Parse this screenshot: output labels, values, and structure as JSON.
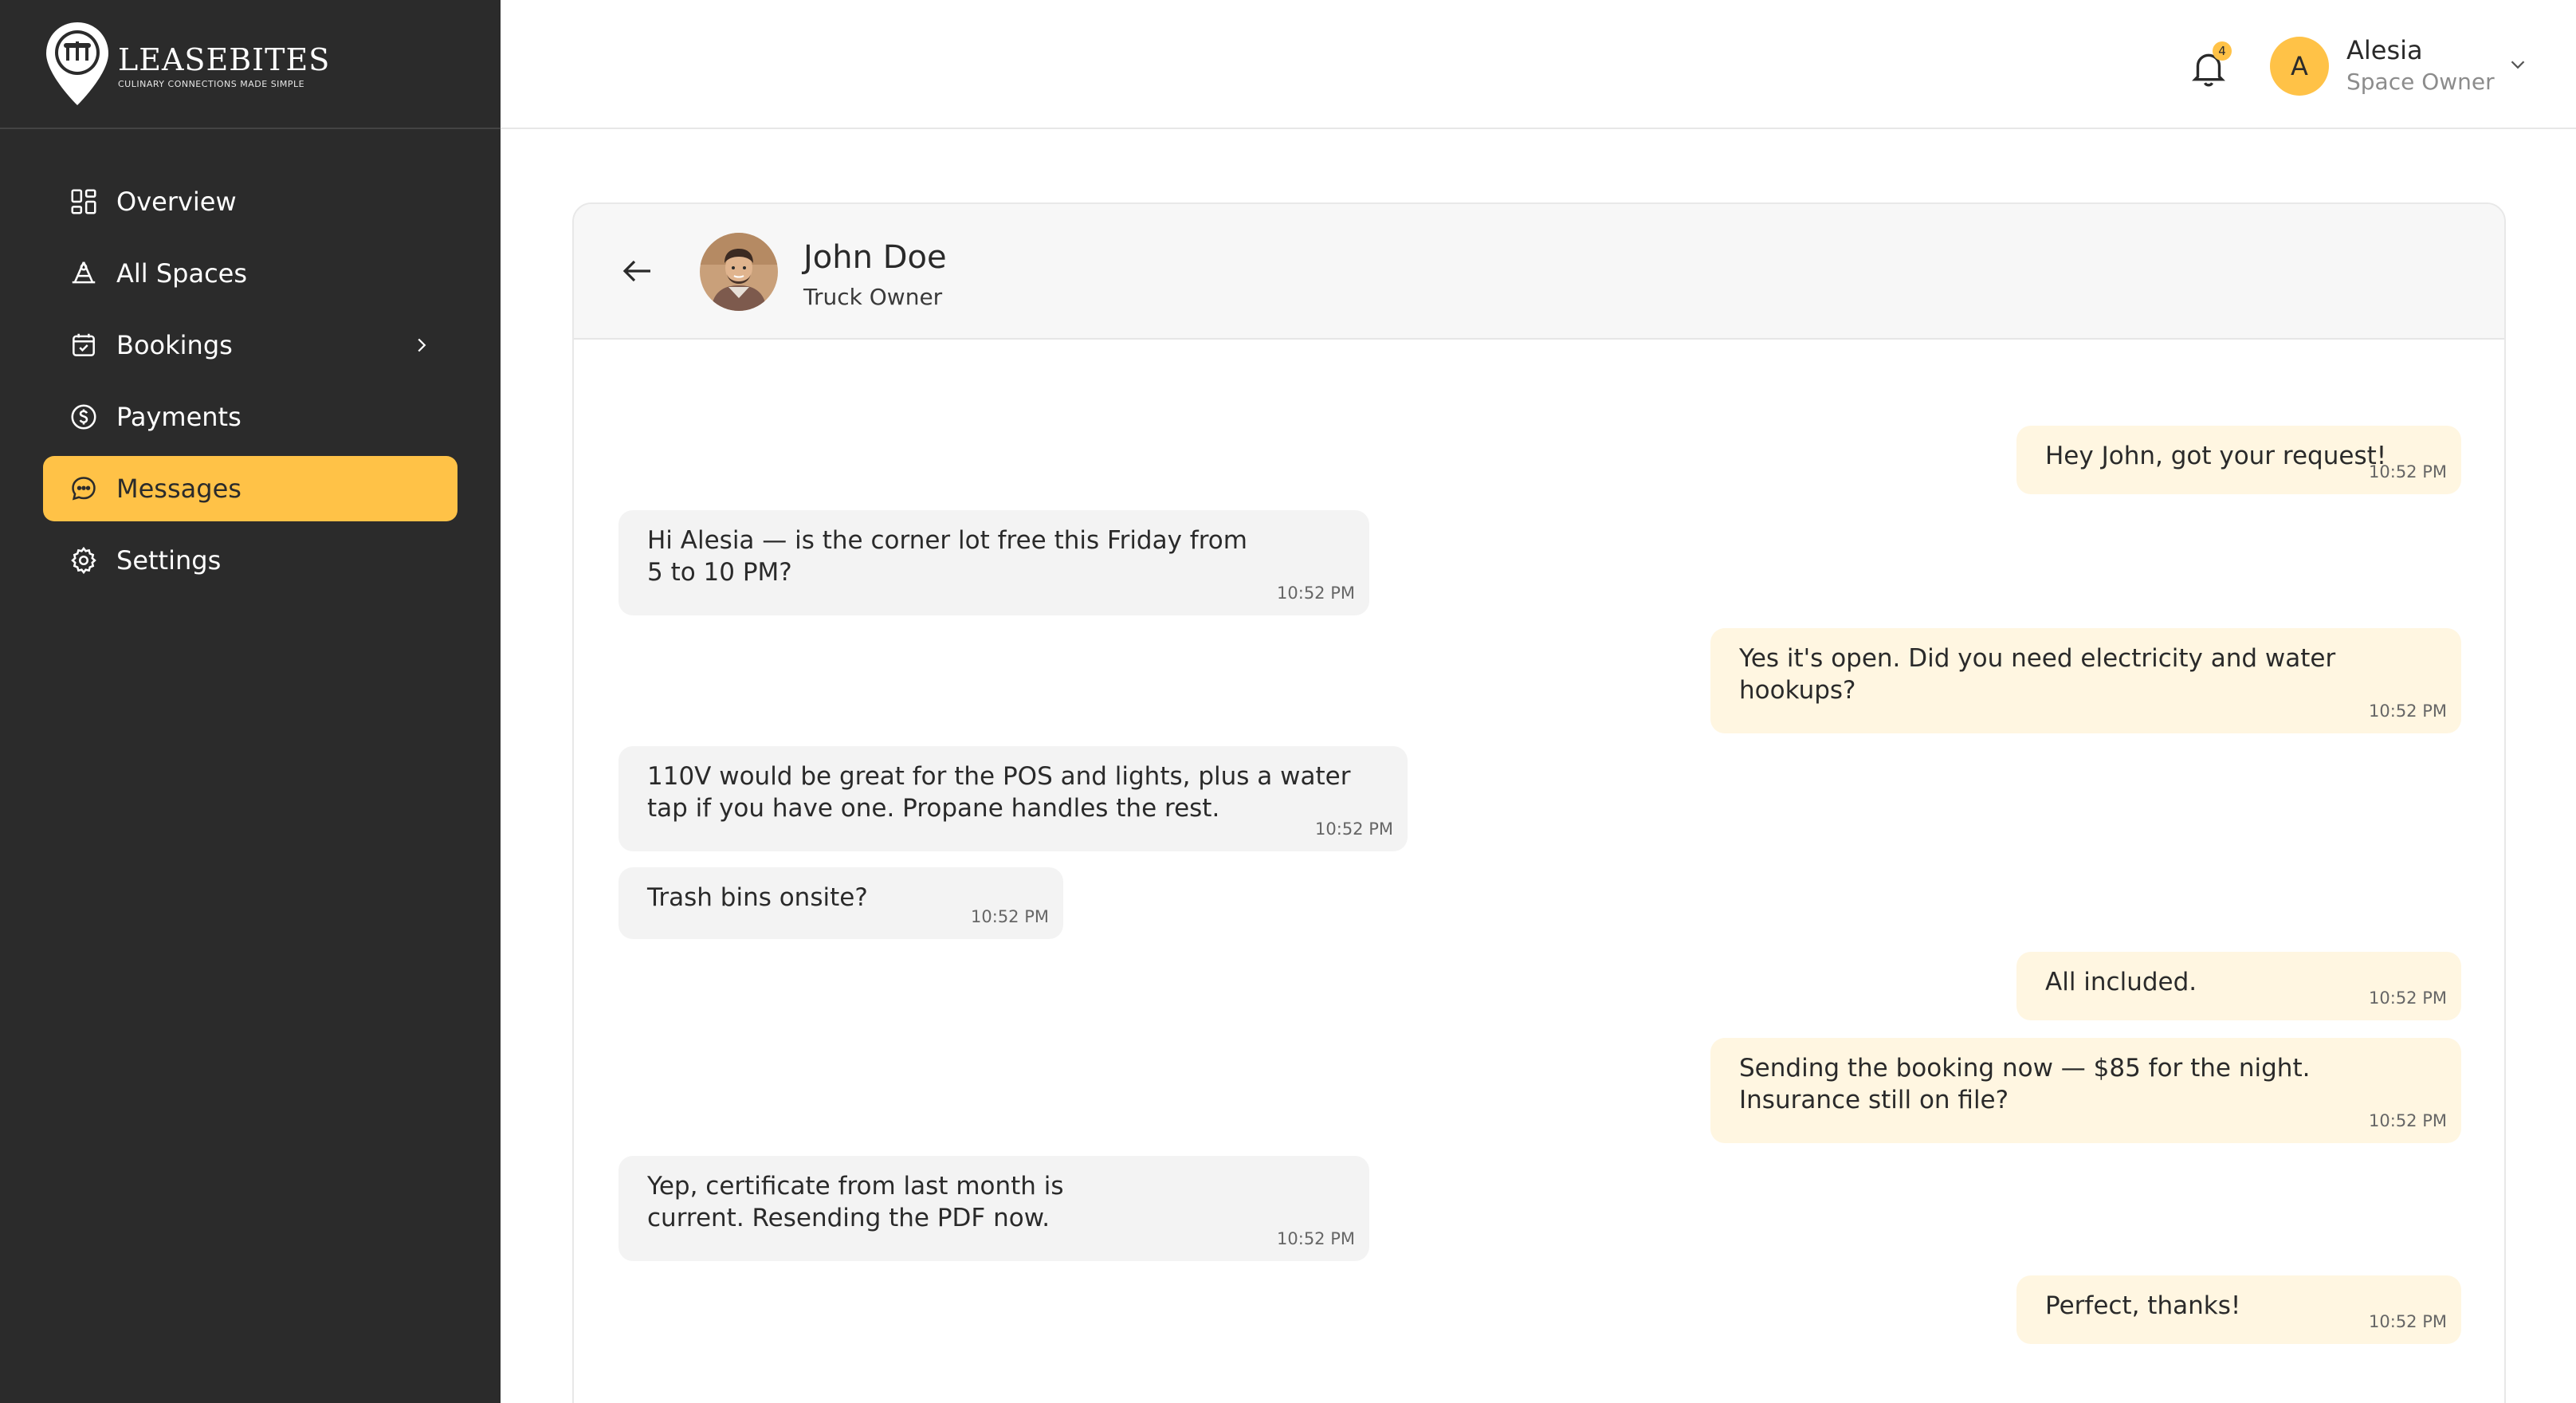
{
  "brand": {
    "name": "LEASEBITES",
    "tagline": "CULINARY CONNECTIONS MADE SIMPLE"
  },
  "sidebar": {
    "items": [
      {
        "label": "Overview",
        "icon": "grid-icon"
      },
      {
        "label": "All Spaces",
        "icon": "spaces-icon"
      },
      {
        "label": "Bookings",
        "icon": "calendar-icon",
        "has_submenu": true
      },
      {
        "label": "Payments",
        "icon": "dollar-circle-icon"
      },
      {
        "label": "Messages",
        "icon": "chat-bubble-icon",
        "active": true
      },
      {
        "label": "Settings",
        "icon": "gear-icon"
      }
    ]
  },
  "header": {
    "notification_count": "4",
    "user": {
      "initial": "A",
      "name": "Alesia",
      "role": "Space Owner"
    }
  },
  "chat": {
    "contact": {
      "name": "John Doe",
      "role": "Truck Owner"
    },
    "messages": [
      {
        "direction": "out",
        "text": "Hey John, got your request!",
        "time": "10:52 PM"
      },
      {
        "direction": "in",
        "text": "Hi Alesia — is the corner lot free this Friday from 5 to 10 PM?",
        "time": "10:52 PM"
      },
      {
        "direction": "out",
        "text": "Yes it's open. Did you need electricity and water hookups?",
        "time": "10:52 PM"
      },
      {
        "direction": "in",
        "text": "110V would be great for the POS and lights, plus a water tap if you have one. Propane handles the rest.",
        "time": "10:52 PM"
      },
      {
        "direction": "in",
        "text": "Trash bins onsite?",
        "time": "10:52 PM"
      },
      {
        "direction": "out",
        "text": "All included.",
        "time": "10:52 PM"
      },
      {
        "direction": "out",
        "text": "Sending the booking now — $85 for the night. Insurance still on file?",
        "time": "10:52 PM"
      },
      {
        "direction": "in",
        "text": "Yep, certificate from last month is current. Resending the PDF now.",
        "time": "10:52 PM"
      },
      {
        "direction": "out",
        "text": "Perfect, thanks!",
        "time": "10:52 PM"
      }
    ]
  },
  "colors": {
    "sidebar_bg": "#2b2b2b",
    "accent": "#ffc247",
    "incoming_bubble": "#f3f3f3",
    "outgoing_bubble": "#fff6e1"
  }
}
